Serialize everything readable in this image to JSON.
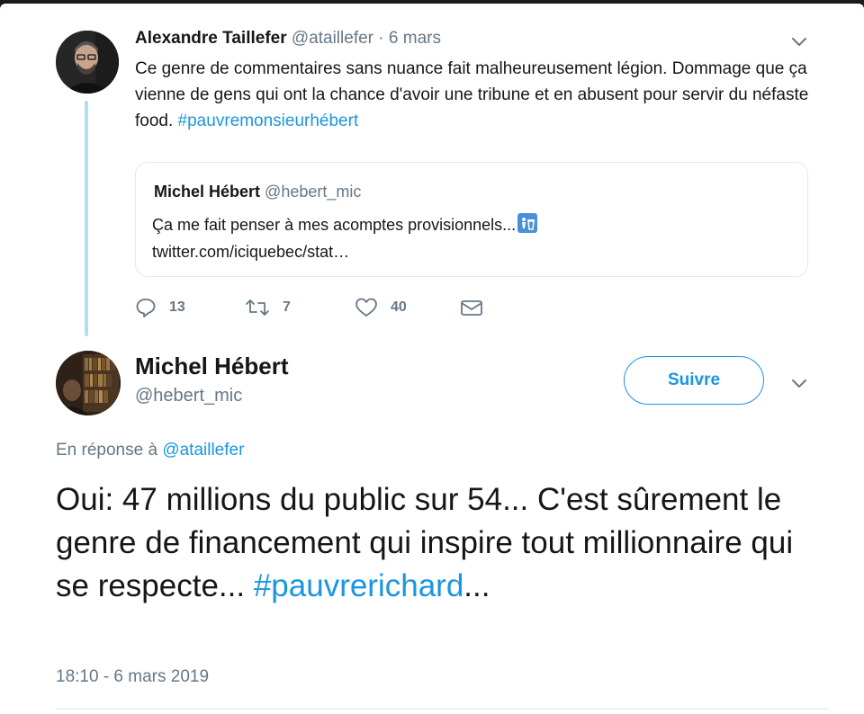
{
  "tweet1": {
    "author_name": "Alexandre Taillefer",
    "handle": "@ataillefer",
    "separator": "·",
    "date": "6 mars",
    "text": "Ce genre de commentaires sans nuance fait malheureusement légion. Dommage que ça vienne de gens qui ont la chance d'avoir une tribune et en abusent pour servir du néfaste food. ",
    "hashtag": "#pauvremonsieurhébert",
    "quote": {
      "author_name": "Michel Hébert",
      "handle": "@hebert_mic",
      "text": "Ça me fait penser à mes acomptes provisionnels...",
      "link": "twitter.com/iciquebec/stat…"
    },
    "actions": {
      "replies": "13",
      "retweets": "7",
      "likes": "40"
    }
  },
  "tweet2": {
    "author_name": "Michel Hébert",
    "handle": "@hebert_mic",
    "follow_label": "Suivre",
    "reply_prefix": "En réponse à ",
    "reply_mention": "@ataillefer",
    "text": "Oui: 47 millions du public sur 54... C'est sûrement le genre de financement qui inspire tout millionnaire qui se respecte... ",
    "hashtag": "#pauvrerichard",
    "text_suffix": "...",
    "timestamp": "18:10 - 6 mars 2019"
  },
  "colors": {
    "accent": "#1b95e0",
    "muted": "#657786",
    "thread_line": "#b3dbf2",
    "border": "#e1e8ed"
  },
  "icons": [
    "chevron-down-icon",
    "reply-icon",
    "retweet-icon",
    "heart-icon",
    "envelope-icon",
    "trash-emoji-icon"
  ]
}
